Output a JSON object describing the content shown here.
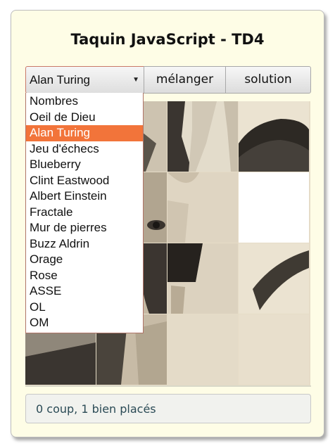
{
  "page": {
    "title": "Taquin JavaScript - TD4"
  },
  "controls": {
    "select_value": "Alan Turing",
    "shuffle_label": "mélanger",
    "solution_label": "solution"
  },
  "dropdown": {
    "options": [
      "Nombres",
      "Oeil de Dieu",
      "Alan Turing",
      "Jeu d'échecs",
      "Blueberry",
      "Clint Eastwood",
      "Albert Einstein",
      "Fractale",
      "Mur de pierres",
      "Buzz Aldrin",
      "Orage",
      "Rose",
      "ASSE",
      "OL",
      "OM"
    ],
    "selected_index": 2
  },
  "board": {
    "grid_size": 4,
    "empty_cell": {
      "row": 1,
      "col": 3
    }
  },
  "status": {
    "text": "0 coup, 1 bien placés"
  },
  "colors": {
    "card_background": "#fefde6",
    "selected_option": "#f2743a",
    "status_text": "#2a4a55"
  }
}
